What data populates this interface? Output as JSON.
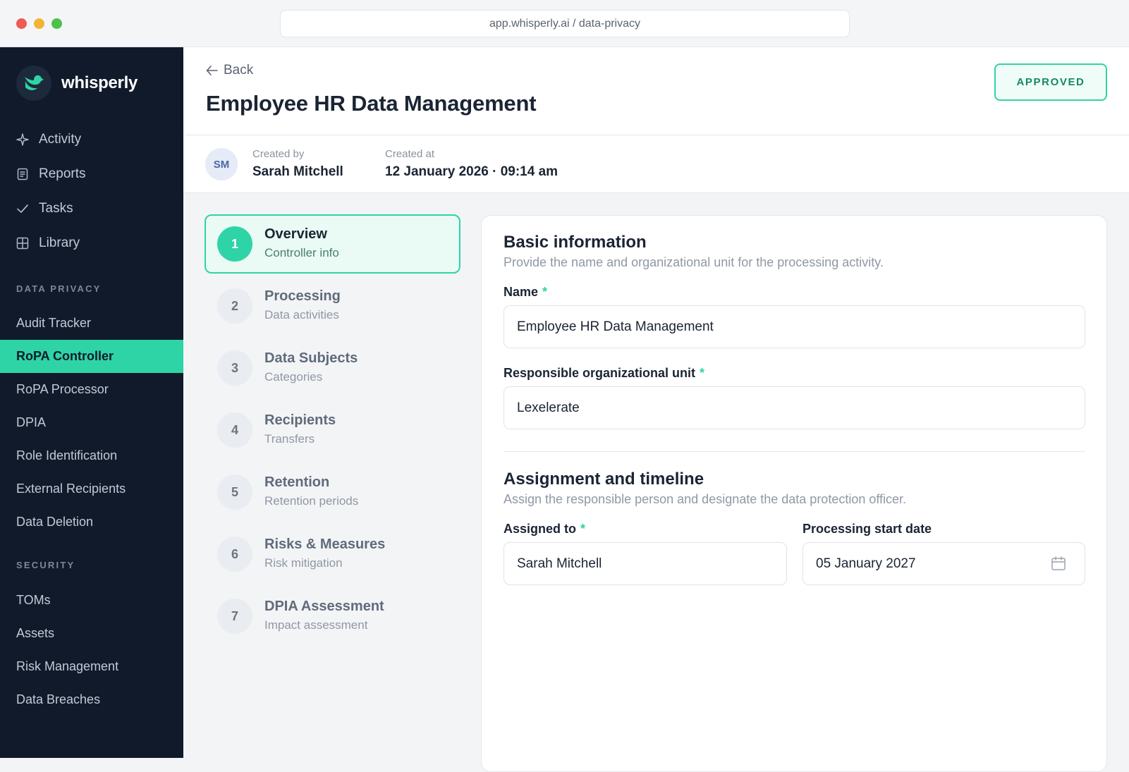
{
  "browser": {
    "url": "app.whisperly.ai / data-privacy"
  },
  "sidebar": {
    "brand": "whisperly",
    "top_items": [
      {
        "label": "Activity",
        "icon": "sparkle-icon"
      },
      {
        "label": "Reports",
        "icon": "document-icon"
      },
      {
        "label": "Tasks",
        "icon": "check-icon"
      },
      {
        "label": "Library",
        "icon": "grid-icon"
      }
    ],
    "data_privacy_label": "DATA PRIVACY",
    "data_privacy_items": [
      "Audit Tracker",
      "RoPA Controller",
      "RoPA Processor",
      "DPIA",
      "Role Identification",
      "External Recipients",
      "Data Deletion"
    ],
    "active_item": "RoPA Controller",
    "security_label": "SECURITY",
    "security_items": [
      "TOMs",
      "Assets",
      "Risk Management",
      "Data Breaches"
    ]
  },
  "header": {
    "back_label": "Back",
    "title": "Employee HR Data Management",
    "status": "APPROVED"
  },
  "meta": {
    "avatar_initials": "SM",
    "created_by_label": "Created by",
    "created_by": "Sarah Mitchell",
    "created_at_label": "Created at",
    "created_at": "12 January 2026 · 09:14 am"
  },
  "steps": [
    {
      "num": "1",
      "title": "Overview",
      "sub": "Controller info"
    },
    {
      "num": "2",
      "title": "Processing",
      "sub": "Data activities"
    },
    {
      "num": "3",
      "title": "Data Subjects",
      "sub": "Categories"
    },
    {
      "num": "4",
      "title": "Recipients",
      "sub": "Transfers"
    },
    {
      "num": "5",
      "title": "Retention",
      "sub": "Retention periods"
    },
    {
      "num": "6",
      "title": "Risks & Measures",
      "sub": "Risk mitigation"
    },
    {
      "num": "7",
      "title": "DPIA Assessment",
      "sub": "Impact assessment"
    }
  ],
  "form": {
    "basic": {
      "title": "Basic information",
      "subtitle": "Provide the name and organizational unit for the processing activity.",
      "name_label": "Name",
      "name_value": "Employee HR Data Management",
      "unit_label": "Responsible organizational unit",
      "unit_value": "Lexelerate"
    },
    "assignment": {
      "title": "Assignment and timeline",
      "subtitle": "Assign the responsible person and designate the data protection officer.",
      "assigned_label": "Assigned to",
      "assigned_value": "Sarah Mitchell",
      "start_label": "Processing start date",
      "start_value": "05 January 2027"
    },
    "required_marker": "*"
  },
  "colors": {
    "accent": "#2fd4a6",
    "sidebar_bg": "#111a2b"
  }
}
